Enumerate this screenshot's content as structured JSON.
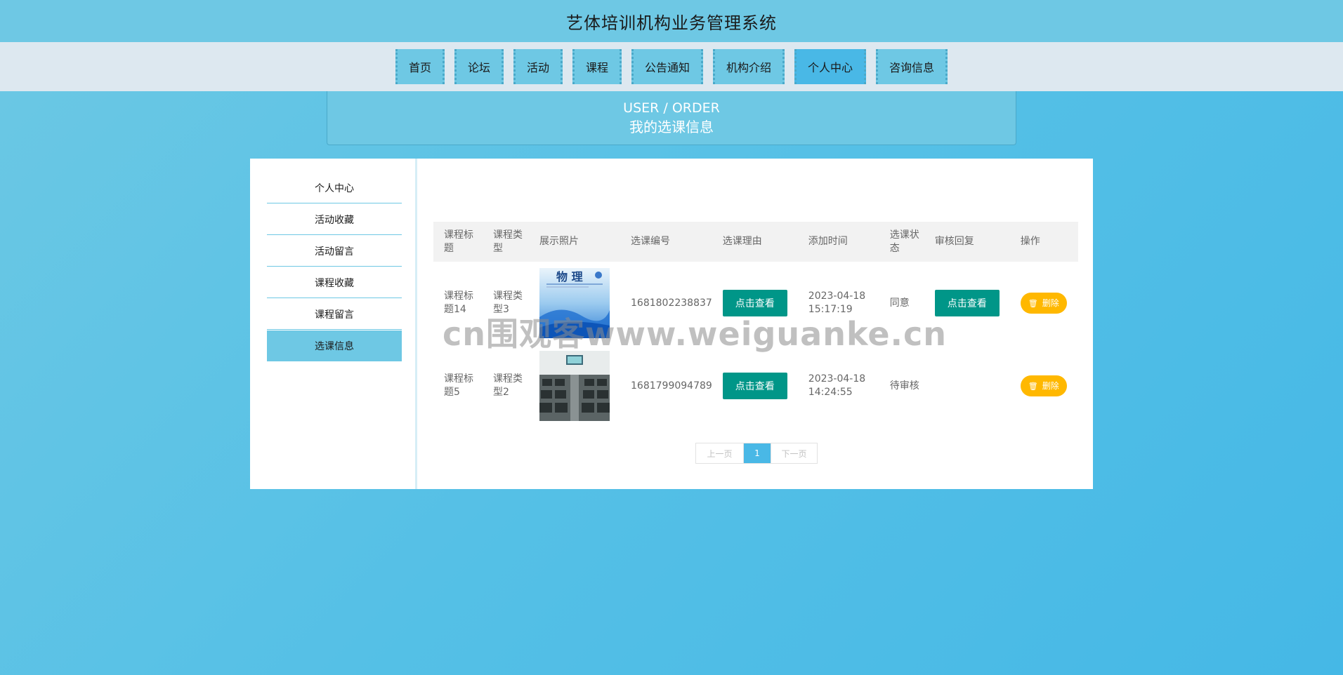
{
  "header": {
    "title": "艺体培训机构业务管理系统"
  },
  "nav": {
    "items": [
      {
        "label": "首页"
      },
      {
        "label": "论坛"
      },
      {
        "label": "活动"
      },
      {
        "label": "课程"
      },
      {
        "label": "公告通知"
      },
      {
        "label": "机构介绍"
      },
      {
        "label": "个人中心",
        "active": true
      },
      {
        "label": "咨询信息"
      }
    ]
  },
  "banner": {
    "en": "USER / ORDER",
    "zh": "我的选课信息"
  },
  "sidebar": {
    "items": [
      {
        "label": "个人中心"
      },
      {
        "label": "活动收藏"
      },
      {
        "label": "活动留言"
      },
      {
        "label": "课程收藏"
      },
      {
        "label": "课程留言"
      },
      {
        "label": "选课信息",
        "active": true
      }
    ]
  },
  "table": {
    "headers": [
      "课程标题",
      "课程类型",
      "展示照片",
      "选课编号",
      "选课理由",
      "添加时间",
      "选课状态",
      "审核回复",
      "操作"
    ],
    "rows": [
      {
        "title": "课程标题14",
        "type": "课程类型3",
        "photo": "physics-book-cover",
        "no": "1681802238837",
        "reason_btn": "点击查看",
        "time": "2023-04-18 15:17:19",
        "status": "同意",
        "reply_btn": "点击查看",
        "delete": "删除"
      },
      {
        "title": "课程标题5",
        "type": "课程类型2",
        "photo": "computer-classroom",
        "no": "1681799094789",
        "reason_btn": "点击查看",
        "time": "2023-04-18 14:24:55",
        "status": "待审核",
        "reply_btn": "",
        "delete": "删除"
      }
    ]
  },
  "pager": {
    "prev": "上一页",
    "current": "1",
    "next": "下一页"
  },
  "watermark": "cn围观客www.weiguanke.cn",
  "colors": {
    "accent": "#6ec8e4",
    "active": "#49b8e6",
    "teal": "#009688",
    "amber": "#ffb800"
  }
}
